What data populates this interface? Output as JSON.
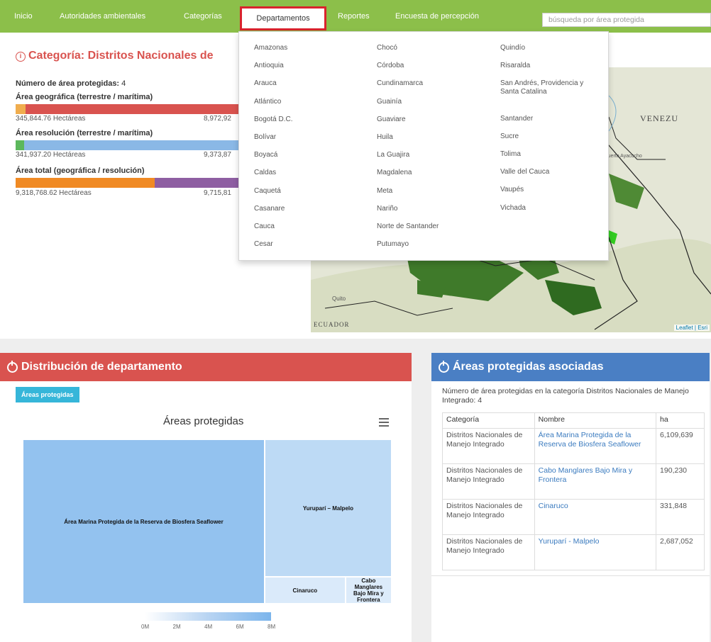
{
  "nav": {
    "items": [
      "Inicio",
      "Autoridades ambientales",
      "Categorías",
      "Departamentos",
      "Reportes",
      "Encuesta de percepción"
    ],
    "search_placeholder": "búsqueda por área protegida",
    "bg_color": "#8cbf4a"
  },
  "category": {
    "title": "Categoría: Distritos Nacionales de",
    "count_label": "Número de área protegidas:",
    "count_value": "4",
    "bars": [
      {
        "label": "Área geográfica (terrestre / marítima)",
        "left_value": "345,844.76 Hectáreas",
        "right_value": "8,972,92"
      },
      {
        "label": "Área resolución (terrestre / marítima)",
        "left_value": "341,937.20 Hectáreas",
        "right_value": "9,373,87"
      },
      {
        "label": "Área total (geográfica / resolución)",
        "left_value": "9,318,768.62 Hectáreas",
        "right_value": "9,715,81"
      }
    ]
  },
  "dropdown": {
    "col1": [
      "Amazonas",
      "Antioquia",
      "Arauca",
      "Atlántico",
      "Bogotá D.C.",
      "Bolívar",
      "Boyacá",
      "Caldas",
      "Caquetá",
      "Casanare",
      "Cauca",
      "Cesar"
    ],
    "col2": [
      "Chocó",
      "Córdoba",
      "Cundinamarca",
      "Guainía",
      "Guaviare",
      "Huila",
      "La Guajira",
      "Magdalena",
      "Meta",
      "Nariño",
      "Norte de Santander",
      "Putumayo"
    ],
    "col3": [
      "Quindío",
      "Risaralda",
      "San Andrés, Providencia y Santa Catalina",
      "Santander",
      "Sucre",
      "Tolima",
      "Valle del Cauca",
      "Vaupés",
      "Vichada"
    ]
  },
  "map": {
    "venezuela": "VENEZU",
    "ecuador": "ECUADOR",
    "quito": "Quito",
    "puerto_ayacucho": "Puerto Ayacucho",
    "attribution": "Leaflet | Esri"
  },
  "distribution": {
    "title": "Distribución de departamento",
    "header_color": "#d9534f",
    "tab_label": "Áreas protegidas",
    "chart_title": "Áreas protegidas",
    "legend_ticks": [
      "0M",
      "2M",
      "4M",
      "6M",
      "8M"
    ]
  },
  "associated": {
    "title": "Áreas protegidas asociadas",
    "header_color": "#4a7fc4",
    "description": "Número de área protegidas en la categoría Distritos Nacionales de Manejo Integrado: 4",
    "columns": [
      "Categoría",
      "Nombre",
      "ha"
    ],
    "rows": [
      {
        "categoria": "Distritos Nacionales de Manejo Integrado",
        "nombre": "Área Marina Protegida de la Reserva de Biosfera Seaflower",
        "ha": "6,109,639"
      },
      {
        "categoria": "Distritos Nacionales de Manejo Integrado",
        "nombre": "Cabo Manglares Bajo Mira y Frontera",
        "ha": "190,230"
      },
      {
        "categoria": "Distritos Nacionales de Manejo Integrado",
        "nombre": "Cinaruco",
        "ha": "331,848"
      },
      {
        "categoria": "Distritos Nacionales de Manejo Integrado",
        "nombre": "Yuruparí - Malpelo",
        "ha": "2,687,052"
      }
    ]
  },
  "chart_data": {
    "type": "heatmap",
    "subtype": "treemap",
    "title": "Áreas protegidas",
    "items": [
      {
        "name": "Área Marina Protegida de la Reserva de Biosfera Seaflower",
        "value": 6109639
      },
      {
        "name": "Yuruparí – Malpelo",
        "value": 2687052
      },
      {
        "name": "Cinaruco",
        "value": 331848
      },
      {
        "name": "Cabo Manglares Bajo Mira y Frontera",
        "value": 190230
      }
    ],
    "color_axis": {
      "min": 0,
      "max": 8000000,
      "ticks": [
        "0M",
        "2M",
        "4M",
        "6M",
        "8M"
      ]
    },
    "legend_placement": "bottom-center"
  }
}
